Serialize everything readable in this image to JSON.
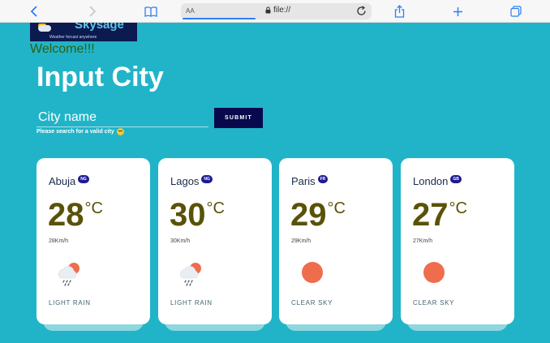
{
  "browser": {
    "text_size_label": "AA",
    "url": "file://"
  },
  "logo": {
    "name": "Skysage",
    "tagline": "Weather forcast anywhere"
  },
  "welcome": "Welcome!!!",
  "title": "Input City",
  "search": {
    "placeholder": "City name",
    "submit_label": "SUBMIT",
    "hint": "Please search for a valid city"
  },
  "cards": [
    {
      "city": "Abuja",
      "country": "NG",
      "temp": "28",
      "unit": "°C",
      "wind": "28Km/h",
      "icon": "light-rain-icon",
      "description": "LIGHT RAIN"
    },
    {
      "city": "Lagos",
      "country": "NG",
      "temp": "30",
      "unit": "°C",
      "wind": "30Km/h",
      "icon": "light-rain-icon",
      "description": "LIGHT RAIN"
    },
    {
      "city": "Paris",
      "country": "FR",
      "temp": "29",
      "unit": "°C",
      "wind": "29Km/h",
      "icon": "clear-sky-icon",
      "description": "CLEAR SKY"
    },
    {
      "city": "London",
      "country": "GB",
      "temp": "27",
      "unit": "°C",
      "wind": "27Km/h",
      "icon": "clear-sky-icon",
      "description": "CLEAR SKY"
    }
  ],
  "colors": {
    "background": "#21b4c8",
    "submit": "#08084d",
    "temperature": "#5a5208",
    "sun": "#ef6c4d",
    "badge": "#1d1b92"
  }
}
